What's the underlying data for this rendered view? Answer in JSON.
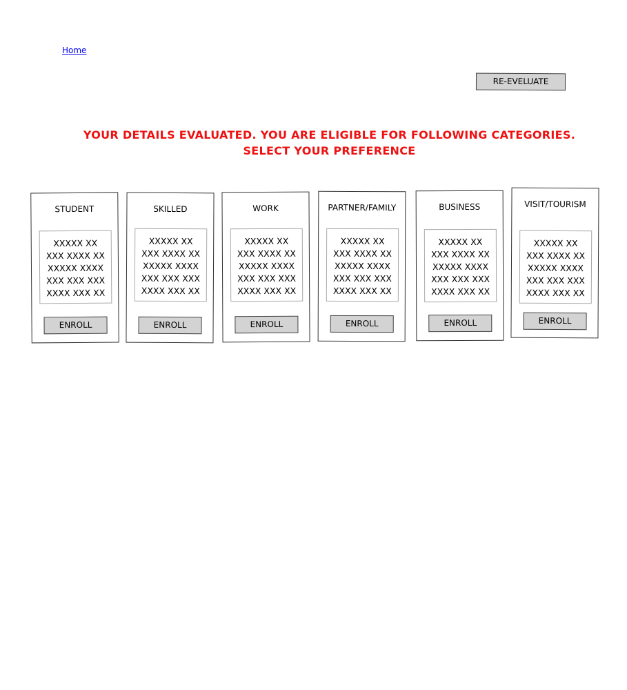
{
  "nav": {
    "home_label": "Home"
  },
  "actions": {
    "reevaluate_label": "RE-EVELUATE"
  },
  "headline": {
    "line1": "YOUR DETAILS EVALUATED. YOU ARE ELIGIBLE FOR FOLLOWING CATEGORIES.",
    "line2": "SELECT YOUR PREFERENCE"
  },
  "colors": {
    "headline": "#ee1111",
    "button_fill": "#d3d3d3",
    "link": "#0000ee"
  },
  "categories": [
    {
      "title": "STUDENT",
      "lines": [
        "XXXXX XX",
        "XXX XXXX XX",
        "XXXXX XXXX",
        "XXX XXX XXX",
        "XXXX XXX XX"
      ],
      "button": "ENROLL"
    },
    {
      "title": "SKILLED",
      "lines": [
        "XXXXX XX",
        "XXX XXXX XX",
        "XXXXX XXXX",
        "XXX XXX XXX",
        "XXXX XXX XX"
      ],
      "button": "ENROLL"
    },
    {
      "title": "WORK",
      "lines": [
        "XXXXX XX",
        "XXX XXXX XX",
        "XXXXX XXXX",
        "XXX XXX XXX",
        "XXXX XXX XX"
      ],
      "button": "ENROLL"
    },
    {
      "title": "PARTNER/FAMILY",
      "lines": [
        "XXXXX XX",
        "XXX XXXX XX",
        "XXXXX XXXX",
        "XXX XXX XXX",
        "XXXX XXX XX"
      ],
      "button": "ENROLL"
    },
    {
      "title": "BUSINESS",
      "lines": [
        "XXXXX XX",
        "XXX XXXX XX",
        "XXXXX XXXX",
        "XXX XXX XXX",
        "XXXX XXX XX"
      ],
      "button": "ENROLL"
    },
    {
      "title": "VISIT/TOURISM",
      "lines": [
        "XXXXX XX",
        "XXX XXXX XX",
        "XXXXX XXXX",
        "XXX XXX XXX",
        "XXXX XXX XX"
      ],
      "button": "ENROLL"
    }
  ]
}
